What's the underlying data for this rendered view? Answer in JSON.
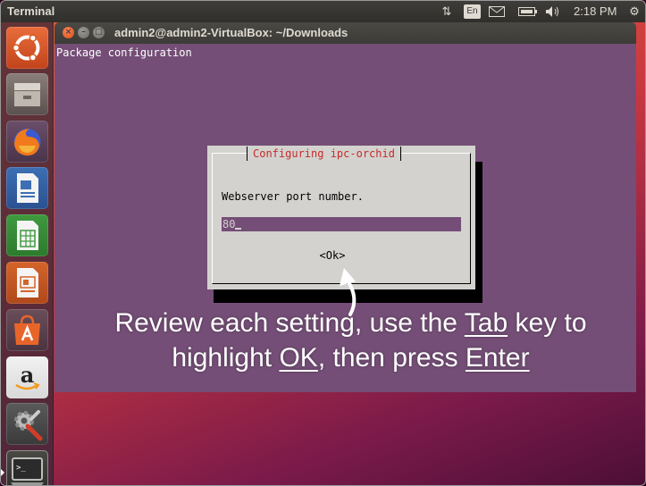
{
  "top_panel": {
    "app_title": "Terminal",
    "lang_indicator": "En",
    "clock": "2:18 PM",
    "icons": [
      "network-arrows-icon",
      "mail-icon",
      "battery-icon",
      "volume-icon",
      "settings-gear-icon"
    ]
  },
  "launcher": {
    "items": [
      {
        "name": "ubuntu-dash-icon",
        "active": false
      },
      {
        "name": "files-icon",
        "active": false
      },
      {
        "name": "firefox-icon",
        "active": false
      },
      {
        "name": "libreoffice-writer-icon",
        "active": false
      },
      {
        "name": "libreoffice-calc-icon",
        "active": false
      },
      {
        "name": "libreoffice-impress-icon",
        "active": false
      },
      {
        "name": "software-center-icon",
        "active": false
      },
      {
        "name": "amazon-icon",
        "active": false
      },
      {
        "name": "system-settings-icon",
        "active": false
      },
      {
        "name": "terminal-icon",
        "active": true
      }
    ]
  },
  "terminal": {
    "title": "admin2@admin2-VirtualBox: ~/Downloads",
    "first_line": "Package configuration"
  },
  "dialog": {
    "title": "Configuring ipc-orchid",
    "label": "Webserver port number.",
    "input_value": "80",
    "ok_label": "<Ok>"
  },
  "caption": {
    "line1_before": "Review each setting, use the ",
    "line1_key": "Tab",
    "line1_after": " key to",
    "line2_before": "highlight ",
    "line2_key": "OK",
    "line2_mid": ", then press ",
    "line2_key2": "Enter"
  },
  "colors": {
    "terminal_bg": "#744e76",
    "dialog_bg": "#d3d2cf",
    "dialog_title": "#c82a2a",
    "close_button": "#df4b15",
    "panel_bg": "#3c3b37"
  }
}
